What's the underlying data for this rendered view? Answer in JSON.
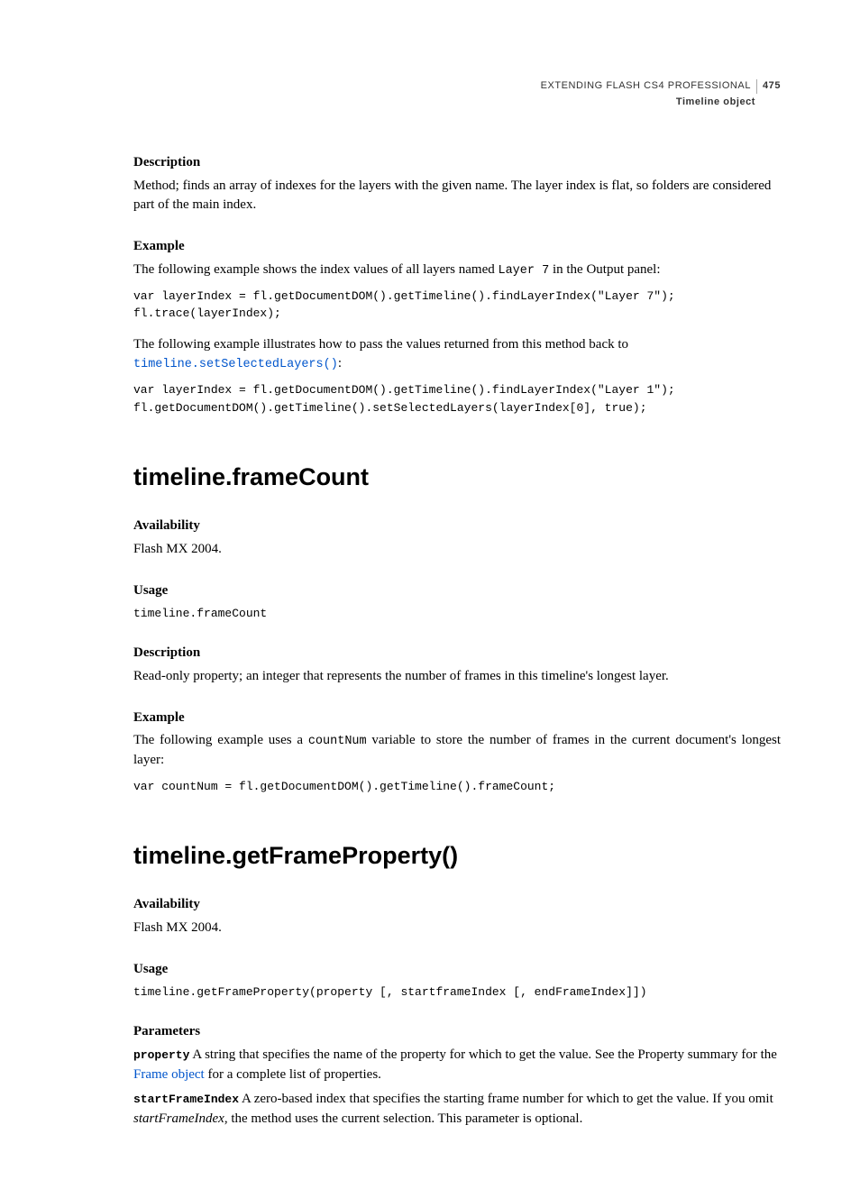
{
  "header": {
    "title": "EXTENDING FLASH CS4 PROFESSIONAL",
    "page": "475",
    "subtitle": "Timeline object"
  },
  "s1": {
    "h_desc": "Description",
    "desc": "Method; finds an array of indexes for the layers with the given name. The layer index is flat, so folders are considered part of the main index.",
    "h_ex": "Example",
    "ex_intro1_a": "The following example shows the index values of all layers named ",
    "ex_intro1_code": "Layer 7",
    "ex_intro1_b": " in the Output panel:",
    "code1": "var layerIndex = fl.getDocumentDOM().getTimeline().findLayerIndex(\"Layer 7\");\nfl.trace(layerIndex);",
    "ex_intro2": "The following example illustrates how to pass the values returned from this method back to ",
    "ex_intro2_link": "timeline.setSelectedLayers()",
    "ex_intro2_after": ":",
    "code2": "var layerIndex = fl.getDocumentDOM().getTimeline().findLayerIndex(\"Layer 1\");\nfl.getDocumentDOM().getTimeline().setSelectedLayers(layerIndex[0], true);"
  },
  "s2": {
    "title": "timeline.frameCount",
    "h_avail": "Availability",
    "avail": "Flash MX 2004.",
    "h_usage": "Usage",
    "usage": "timeline.frameCount",
    "h_desc": "Description",
    "desc": "Read-only property; an integer that represents the number of frames in this timeline's longest layer.",
    "h_ex": "Example",
    "ex_intro_a": "The following example uses a ",
    "ex_intro_code": "countNum",
    "ex_intro_b": " variable to store the number of frames in the current document's longest layer:",
    "code": "var countNum = fl.getDocumentDOM().getTimeline().frameCount;"
  },
  "s3": {
    "title": "timeline.getFrameProperty()",
    "h_avail": "Availability",
    "avail": "Flash MX 2004.",
    "h_usage": "Usage",
    "usage": "timeline.getFrameProperty(property [, startframeIndex [, endFrameIndex]])",
    "h_params": "Parameters",
    "p1_name": "property",
    "p1_text_a": "  A string that specifies the name of the property for which to get the value. See the Property summary for the ",
    "p1_link": "Frame object",
    "p1_text_b": " for a complete list of properties.",
    "p2_name": "startFrameIndex",
    "p2_text_a": "  A zero-based index that specifies the starting frame number for which to get the value. If you omit ",
    "p2_italic": "startFrameIndex",
    "p2_text_b": ", the method uses the current selection. This parameter is optional."
  }
}
